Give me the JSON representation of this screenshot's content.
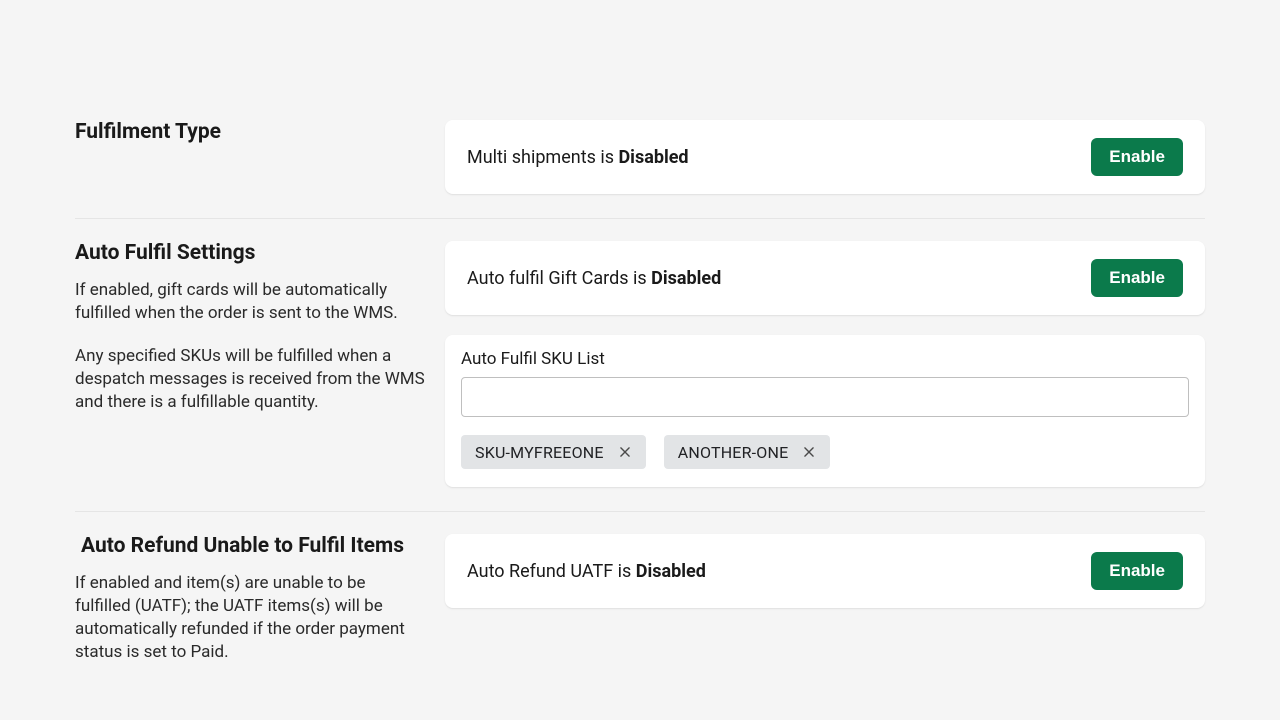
{
  "colors": {
    "accent": "#0b7a4b"
  },
  "buttons": {
    "enable": "Enable"
  },
  "sections": {
    "fulfilment_type": {
      "title": "Fulfilment Type",
      "status_prefix": "Multi shipments is ",
      "status_state": "Disabled"
    },
    "auto_fulfil": {
      "title": "Auto Fulfil Settings",
      "desc1": "If enabled, gift cards will be automatically fulfilled when the order is sent to the WMS.",
      "desc2": "Any specified SKUs will be fulfilled when a despatch messages is received from the WMS and there is a fulfillable quantity.",
      "giftcards_prefix": "Auto fulfil Gift Cards is ",
      "giftcards_state": "Disabled",
      "sku_list_label": "Auto Fulfil SKU List",
      "sku_input_value": "",
      "sku_chips": [
        "SKU-MYFREEONE",
        "ANOTHER-ONE"
      ]
    },
    "auto_refund": {
      "title": "Auto Refund Unable to Fulfil Items",
      "desc": "If enabled and item(s) are unable to be fulfilled (UATF); the UATF items(s) will be automatically refunded if the order payment status is set to Paid.",
      "status_prefix": "Auto Refund UATF is ",
      "status_state": "Disabled"
    }
  }
}
